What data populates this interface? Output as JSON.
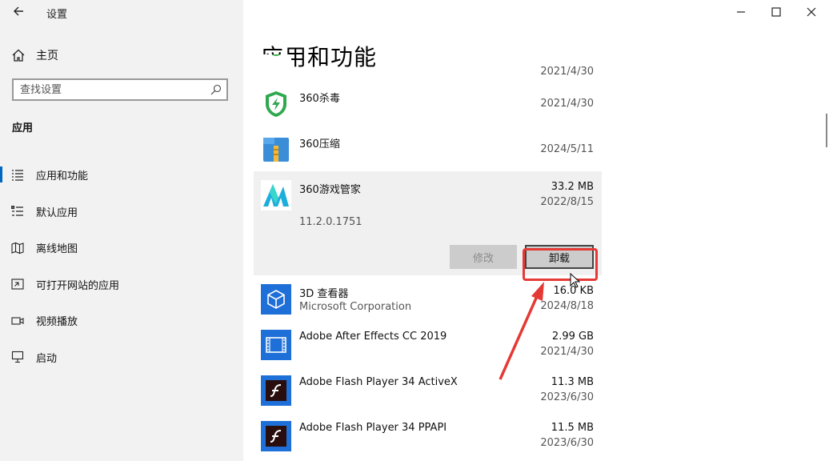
{
  "window": {
    "title": "设置",
    "back_icon": "back-arrow-icon",
    "controls": [
      "minimize-icon",
      "maximize-icon",
      "close-icon"
    ]
  },
  "sidebar": {
    "home": {
      "label": "主页",
      "icon": "home-icon"
    },
    "search": {
      "placeholder": "查找设置",
      "icon": "search-icon"
    },
    "section": "应用",
    "items": [
      {
        "label": "应用和功能",
        "icon": "apps-features-icon",
        "selected": true
      },
      {
        "label": "默认应用",
        "icon": "default-apps-icon",
        "selected": false
      },
      {
        "label": "离线地图",
        "icon": "offline-maps-icon",
        "selected": false
      },
      {
        "label": "可打开网站的应用",
        "icon": "apps-for-websites-icon",
        "selected": false
      },
      {
        "label": "视频播放",
        "icon": "video-playback-icon",
        "selected": false
      },
      {
        "label": "启动",
        "icon": "startup-icon",
        "selected": false
      }
    ]
  },
  "main": {
    "title": "应用和功能",
    "apps": [
      {
        "name": "",
        "publisher": "",
        "size": "",
        "date": "2021/4/30",
        "icon": "green-app-icon"
      },
      {
        "name": "360杀毒",
        "publisher": "",
        "size": "",
        "date": "2021/4/30",
        "icon": "shield-bolt-icon"
      },
      {
        "name": "360压缩",
        "publisher": "",
        "size": "",
        "date": "2024/5/11",
        "icon": "archive-icon"
      },
      {
        "name": "360游戏管家",
        "publisher": "",
        "size": "33.2 MB",
        "date": "2022/8/15",
        "version": "11.2.0.1751",
        "icon": "game-manager-icon",
        "expanded": true
      },
      {
        "name": "3D 查看器",
        "publisher": "Microsoft Corporation",
        "size": "16.0 KB",
        "date": "2024/8/18",
        "icon": "cube-icon"
      },
      {
        "name": "Adobe After Effects CC 2019",
        "publisher": "",
        "size": "2.99 GB",
        "date": "2021/4/30",
        "icon": "filmstrip-icon"
      },
      {
        "name": "Adobe Flash Player 34 ActiveX",
        "publisher": "",
        "size": "11.3 MB",
        "date": "2023/6/30",
        "icon": "flash-icon"
      },
      {
        "name": "Adobe Flash Player 34 PPAPI",
        "publisher": "",
        "size": "11.5 MB",
        "date": "2023/6/30",
        "icon": "flash-icon"
      }
    ],
    "buttons": {
      "modify": "修改",
      "uninstall": "卸载"
    }
  },
  "colors": {
    "accent": "#0067c0",
    "highlight": "#e53935",
    "sidebar_bg": "#f2f2f2",
    "expanded_bg": "#f0f0f0"
  }
}
